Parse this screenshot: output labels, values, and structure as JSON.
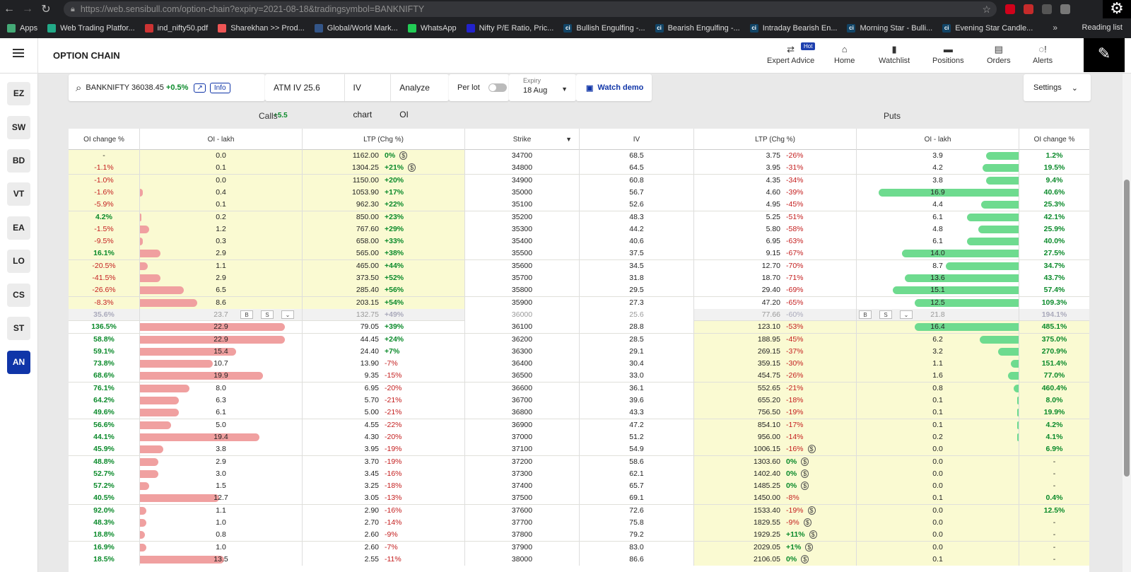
{
  "browser": {
    "url": "https://web.sensibull.com/option-chain?expiry=2021-08-18&tradingsymbol=BANKNIFTY",
    "bookmarks": [
      "Apps",
      "Web Trading Platfor...",
      "ind_nifty50.pdf",
      "Sharekhan >> Prod...",
      "Global/World Mark...",
      "WhatsApp",
      "Nifty P/E Ratio, Pric...",
      "Bullish Engulfing -...",
      "Bearish Engulfing -...",
      "Intraday Bearish En...",
      "Morning Star - Bulli...",
      "Evening Star Candle..."
    ],
    "more": "»",
    "reading_list": "Reading list"
  },
  "header": {
    "title": "OPTION CHAIN",
    "hot_badge": "Hot",
    "nav": [
      "Expert Advice",
      "Home",
      "Watchlist",
      "Positions",
      "Orders",
      "Alerts"
    ]
  },
  "sidebar": [
    "EZ",
    "SW",
    "BD",
    "VT",
    "EA",
    "LO",
    "CS",
    "ST",
    "AN"
  ],
  "toolbar": {
    "symbol": "BANKNIFTY 36038.45",
    "symbol_change": "+0.5%",
    "info": "Info",
    "atm_iv_label": "ATM IV 25.6",
    "atm_iv_change": "+5.5",
    "iv_chart": "IV chart",
    "analyze_oi": "Analyze OI",
    "per_lot": "Per lot",
    "expiry_label": "Expiry",
    "expiry_value": "18 Aug",
    "watch_demo": "Watch demo",
    "settings": "Settings"
  },
  "sections": {
    "calls": "Calls",
    "puts": "Puts"
  },
  "columns": {
    "oi_change": "OI change %",
    "oi_lakh": "OI - lakh",
    "ltp": "LTP (Chg %)",
    "strike": "Strike",
    "iv": "IV"
  },
  "rows": [
    {
      "cchg": "-",
      "coi": "0.0",
      "cltp": "1162.00",
      "cltpc": "0%",
      "cnse": true,
      "strike": "34700",
      "iv": "68.5",
      "pltp": "3.75",
      "pltpc": "-26%",
      "pnse": false,
      "poi": "3.9",
      "pchg": "1.2%",
      "cbar": 0,
      "pbar": 0.21
    },
    {
      "cchg": "-1.1%",
      "coi": "0.1",
      "cltp": "1304.25",
      "cltpc": "+21%",
      "cnse": true,
      "strike": "34800",
      "iv": "64.5",
      "pltp": "3.95",
      "pltpc": "-31%",
      "pnse": false,
      "poi": "4.2",
      "pchg": "19.5%",
      "cbar": 0,
      "pbar": 0.23
    },
    {
      "cchg": "-1.0%",
      "coi": "0.0",
      "cltp": "1150.00",
      "cltpc": "+20%",
      "cnse": false,
      "strike": "34900",
      "iv": "60.8",
      "pltp": "4.35",
      "pltpc": "-34%",
      "pnse": false,
      "poi": "3.8",
      "pchg": "9.4%",
      "cbar": 0,
      "pbar": 0.21
    },
    {
      "cchg": "-1.6%",
      "coi": "0.4",
      "cltp": "1053.90",
      "cltpc": "+17%",
      "cnse": false,
      "strike": "35000",
      "iv": "56.7",
      "pltp": "4.60",
      "pltpc": "-39%",
      "pnse": false,
      "poi": "16.9",
      "pchg": "40.6%",
      "cbar": 0.02,
      "pbar": 0.9
    },
    {
      "cchg": "-5.9%",
      "coi": "0.1",
      "cltp": "962.30",
      "cltpc": "+22%",
      "cnse": false,
      "strike": "35100",
      "iv": "52.6",
      "pltp": "4.95",
      "pltpc": "-45%",
      "pnse": false,
      "poi": "4.4",
      "pchg": "25.3%",
      "cbar": 0,
      "pbar": 0.24
    },
    {
      "cchg": "4.2%",
      "coi": "0.2",
      "cltp": "850.00",
      "cltpc": "+23%",
      "cnse": false,
      "strike": "35200",
      "iv": "48.3",
      "pltp": "5.25",
      "pltpc": "-51%",
      "pnse": false,
      "poi": "6.1",
      "pchg": "42.1%",
      "cbar": 0.01,
      "pbar": 0.33
    },
    {
      "cchg": "-1.5%",
      "coi": "1.2",
      "cltp": "767.60",
      "cltpc": "+29%",
      "cnse": false,
      "strike": "35300",
      "iv": "44.2",
      "pltp": "5.80",
      "pltpc": "-58%",
      "pnse": false,
      "poi": "4.8",
      "pchg": "25.9%",
      "cbar": 0.06,
      "pbar": 0.26
    },
    {
      "cchg": "-9.5%",
      "coi": "0.3",
      "cltp": "658.00",
      "cltpc": "+33%",
      "cnse": false,
      "strike": "35400",
      "iv": "40.6",
      "pltp": "6.95",
      "pltpc": "-63%",
      "pnse": false,
      "poi": "6.1",
      "pchg": "40.0%",
      "cbar": 0.02,
      "pbar": 0.33
    },
    {
      "cchg": "16.1%",
      "coi": "2.9",
      "cltp": "565.00",
      "cltpc": "+38%",
      "cnse": false,
      "strike": "35500",
      "iv": "37.5",
      "pltp": "9.15",
      "pltpc": "-67%",
      "pnse": false,
      "poi": "14.0",
      "pchg": "27.5%",
      "cbar": 0.13,
      "pbar": 0.75
    },
    {
      "cchg": "-20.5%",
      "coi": "1.1",
      "cltp": "465.00",
      "cltpc": "+44%",
      "cnse": false,
      "strike": "35600",
      "iv": "34.5",
      "pltp": "12.70",
      "pltpc": "-70%",
      "pnse": false,
      "poi": "8.7",
      "pchg": "34.7%",
      "cbar": 0.05,
      "pbar": 0.47
    },
    {
      "cchg": "-41.5%",
      "coi": "2.9",
      "cltp": "373.50",
      "cltpc": "+52%",
      "cnse": false,
      "strike": "35700",
      "iv": "31.8",
      "pltp": "18.70",
      "pltpc": "-71%",
      "pnse": false,
      "poi": "13.6",
      "pchg": "43.7%",
      "cbar": 0.13,
      "pbar": 0.73
    },
    {
      "cchg": "-26.6%",
      "coi": "6.5",
      "cltp": "285.40",
      "cltpc": "+56%",
      "cnse": false,
      "strike": "35800",
      "iv": "29.5",
      "pltp": "29.40",
      "pltpc": "-69%",
      "pnse": false,
      "poi": "15.1",
      "pchg": "57.4%",
      "cbar": 0.28,
      "pbar": 0.81
    },
    {
      "cchg": "-8.3%",
      "coi": "8.6",
      "cltp": "203.15",
      "cltpc": "+54%",
      "cnse": false,
      "strike": "35900",
      "iv": "27.3",
      "pltp": "47.20",
      "pltpc": "-65%",
      "pnse": false,
      "poi": "12.5",
      "pchg": "109.3%",
      "cbar": 0.37,
      "pbar": 0.67
    },
    {
      "atm": true,
      "cchg": "35.6%",
      "coi": "23.7",
      "cltp": "132.75",
      "cltpc": "+49%",
      "cnse": false,
      "strike": "36000",
      "iv": "25.6",
      "pltp": "77.66",
      "pltpc": "-60%",
      "pnse": false,
      "poi": "21.8",
      "pchg": "194.1%",
      "cbar": 0,
      "pbar": 0
    },
    {
      "cchg": "136.5%",
      "coi": "22.9",
      "cltp": "79.05",
      "cltpc": "+39%",
      "cnse": false,
      "strike": "36100",
      "iv": "28.8",
      "pltp": "123.10",
      "pltpc": "-53%",
      "pnse": false,
      "poi": "16.4",
      "pchg": "485.1%",
      "cbar": 0.93,
      "pbar": 0.67
    },
    {
      "cchg": "58.8%",
      "coi": "22.9",
      "cltp": "44.45",
      "cltpc": "+24%",
      "cnse": false,
      "strike": "36200",
      "iv": "28.5",
      "pltp": "188.95",
      "pltpc": "-45%",
      "pnse": false,
      "poi": "6.2",
      "pchg": "375.0%",
      "cbar": 0.93,
      "pbar": 0.25
    },
    {
      "cchg": "59.1%",
      "coi": "15.4",
      "cltp": "24.40",
      "cltpc": "+7%",
      "cnse": false,
      "strike": "36300",
      "iv": "29.1",
      "pltp": "269.15",
      "pltpc": "-37%",
      "pnse": false,
      "poi": "3.2",
      "pchg": "270.9%",
      "cbar": 0.62,
      "pbar": 0.13
    },
    {
      "cchg": "73.8%",
      "coi": "10.7",
      "cltp": "13.90",
      "cltpc": "-7%",
      "cnse": false,
      "strike": "36400",
      "iv": "30.4",
      "pltp": "359.15",
      "pltpc": "-30%",
      "pnse": false,
      "poi": "1.1",
      "pchg": "151.4%",
      "cbar": 0.47,
      "pbar": 0.05
    },
    {
      "cchg": "68.6%",
      "coi": "19.9",
      "cltp": "9.35",
      "cltpc": "-15%",
      "cnse": false,
      "strike": "36500",
      "iv": "33.0",
      "pltp": "454.75",
      "pltpc": "-26%",
      "pnse": false,
      "poi": "1.6",
      "pchg": "77.0%",
      "cbar": 0.79,
      "pbar": 0.07
    },
    {
      "cchg": "76.1%",
      "coi": "8.0",
      "cltp": "6.95",
      "cltpc": "-20%",
      "cnse": false,
      "strike": "36600",
      "iv": "36.1",
      "pltp": "552.65",
      "pltpc": "-21%",
      "pnse": false,
      "poi": "0.8",
      "pchg": "460.4%",
      "cbar": 0.32,
      "pbar": 0.03
    },
    {
      "cchg": "64.2%",
      "coi": "6.3",
      "cltp": "5.70",
      "cltpc": "-21%",
      "cnse": false,
      "strike": "36700",
      "iv": "39.6",
      "pltp": "655.20",
      "pltpc": "-18%",
      "pnse": false,
      "poi": "0.1",
      "pchg": "8.0%",
      "cbar": 0.25,
      "pbar": 0.01
    },
    {
      "cchg": "49.6%",
      "coi": "6.1",
      "cltp": "5.00",
      "cltpc": "-21%",
      "cnse": false,
      "strike": "36800",
      "iv": "43.3",
      "pltp": "756.50",
      "pltpc": "-19%",
      "pnse": false,
      "poi": "0.1",
      "pchg": "19.9%",
      "cbar": 0.25,
      "pbar": 0.01
    },
    {
      "cchg": "56.6%",
      "coi": "5.0",
      "cltp": "4.55",
      "cltpc": "-22%",
      "cnse": false,
      "strike": "36900",
      "iv": "47.2",
      "pltp": "854.10",
      "pltpc": "-17%",
      "pnse": false,
      "poi": "0.1",
      "pchg": "4.2%",
      "cbar": 0.2,
      "pbar": 0.01
    },
    {
      "cchg": "44.1%",
      "coi": "19.4",
      "cltp": "4.30",
      "cltpc": "-20%",
      "cnse": false,
      "strike": "37000",
      "iv": "51.2",
      "pltp": "956.00",
      "pltpc": "-14%",
      "pnse": false,
      "poi": "0.2",
      "pchg": "4.1%",
      "cbar": 0.77,
      "pbar": 0.01
    },
    {
      "cchg": "45.9%",
      "coi": "3.8",
      "cltp": "3.95",
      "cltpc": "-19%",
      "cnse": false,
      "strike": "37100",
      "iv": "54.9",
      "pltp": "1006.15",
      "pltpc": "-16%",
      "pnse": true,
      "poi": "0.0",
      "pchg": "6.9%",
      "cbar": 0.15,
      "pbar": 0
    },
    {
      "cchg": "48.8%",
      "coi": "2.9",
      "cltp": "3.70",
      "cltpc": "-19%",
      "cnse": false,
      "strike": "37200",
      "iv": "58.6",
      "pltp": "1303.60",
      "pltpc": "0%",
      "pnse": true,
      "poi": "0.0",
      "pchg": "-",
      "cbar": 0.12,
      "pbar": 0
    },
    {
      "cchg": "52.7%",
      "coi": "3.0",
      "cltp": "3.45",
      "cltpc": "-16%",
      "cnse": false,
      "strike": "37300",
      "iv": "62.1",
      "pltp": "1402.40",
      "pltpc": "0%",
      "pnse": true,
      "poi": "0.0",
      "pchg": "-",
      "cbar": 0.12,
      "pbar": 0
    },
    {
      "cchg": "57.2%",
      "coi": "1.5",
      "cltp": "3.25",
      "cltpc": "-18%",
      "cnse": false,
      "strike": "37400",
      "iv": "65.7",
      "pltp": "1485.25",
      "pltpc": "0%",
      "pnse": true,
      "poi": "0.0",
      "pchg": "-",
      "cbar": 0.06,
      "pbar": 0
    },
    {
      "cchg": "40.5%",
      "coi": "12.7",
      "cltp": "3.05",
      "cltpc": "-13%",
      "cnse": false,
      "strike": "37500",
      "iv": "69.1",
      "pltp": "1450.00",
      "pltpc": "-8%",
      "pnse": false,
      "poi": "0.1",
      "pchg": "0.4%",
      "cbar": 0.51,
      "pbar": 0
    },
    {
      "cchg": "92.0%",
      "coi": "1.1",
      "cltp": "2.90",
      "cltpc": "-16%",
      "cnse": false,
      "strike": "37600",
      "iv": "72.6",
      "pltp": "1533.40",
      "pltpc": "-19%",
      "pnse": true,
      "poi": "0.0",
      "pchg": "12.5%",
      "cbar": 0.04,
      "pbar": 0
    },
    {
      "cchg": "48.3%",
      "coi": "1.0",
      "cltp": "2.70",
      "cltpc": "-14%",
      "cnse": false,
      "strike": "37700",
      "iv": "75.8",
      "pltp": "1829.55",
      "pltpc": "-9%",
      "pnse": true,
      "poi": "0.0",
      "pchg": "-",
      "cbar": 0.04,
      "pbar": 0
    },
    {
      "cchg": "18.8%",
      "coi": "0.8",
      "cltp": "2.60",
      "cltpc": "-9%",
      "cnse": false,
      "strike": "37800",
      "iv": "79.2",
      "pltp": "1929.25",
      "pltpc": "+11%",
      "pnse": true,
      "poi": "0.0",
      "pchg": "-",
      "cbar": 0.03,
      "pbar": 0
    },
    {
      "cchg": "16.9%",
      "coi": "1.0",
      "cltp": "2.60",
      "cltpc": "-7%",
      "cnse": false,
      "strike": "37900",
      "iv": "83.0",
      "pltp": "2029.05",
      "pltpc": "+1%",
      "pnse": true,
      "poi": "0.0",
      "pchg": "-",
      "cbar": 0.04,
      "pbar": 0
    },
    {
      "cchg": "18.5%",
      "coi": "13.5",
      "cltp": "2.55",
      "cltpc": "-11%",
      "cnse": false,
      "strike": "38000",
      "iv": "86.6",
      "pltp": "2106.05",
      "pltpc": "0%",
      "pnse": true,
      "poi": "0.1",
      "pchg": "-",
      "cbar": 0.54,
      "pbar": 0
    }
  ],
  "atm_buttons": {
    "buy": "B",
    "sell": "S",
    "more": "⌄"
  },
  "colors": {
    "accent": "#1035a8",
    "up": "#0a8a2a",
    "down": "#c41e1e",
    "itm": "#fafad2",
    "call_bar": "#f0a0a0",
    "put_bar": "#6edb8f"
  }
}
